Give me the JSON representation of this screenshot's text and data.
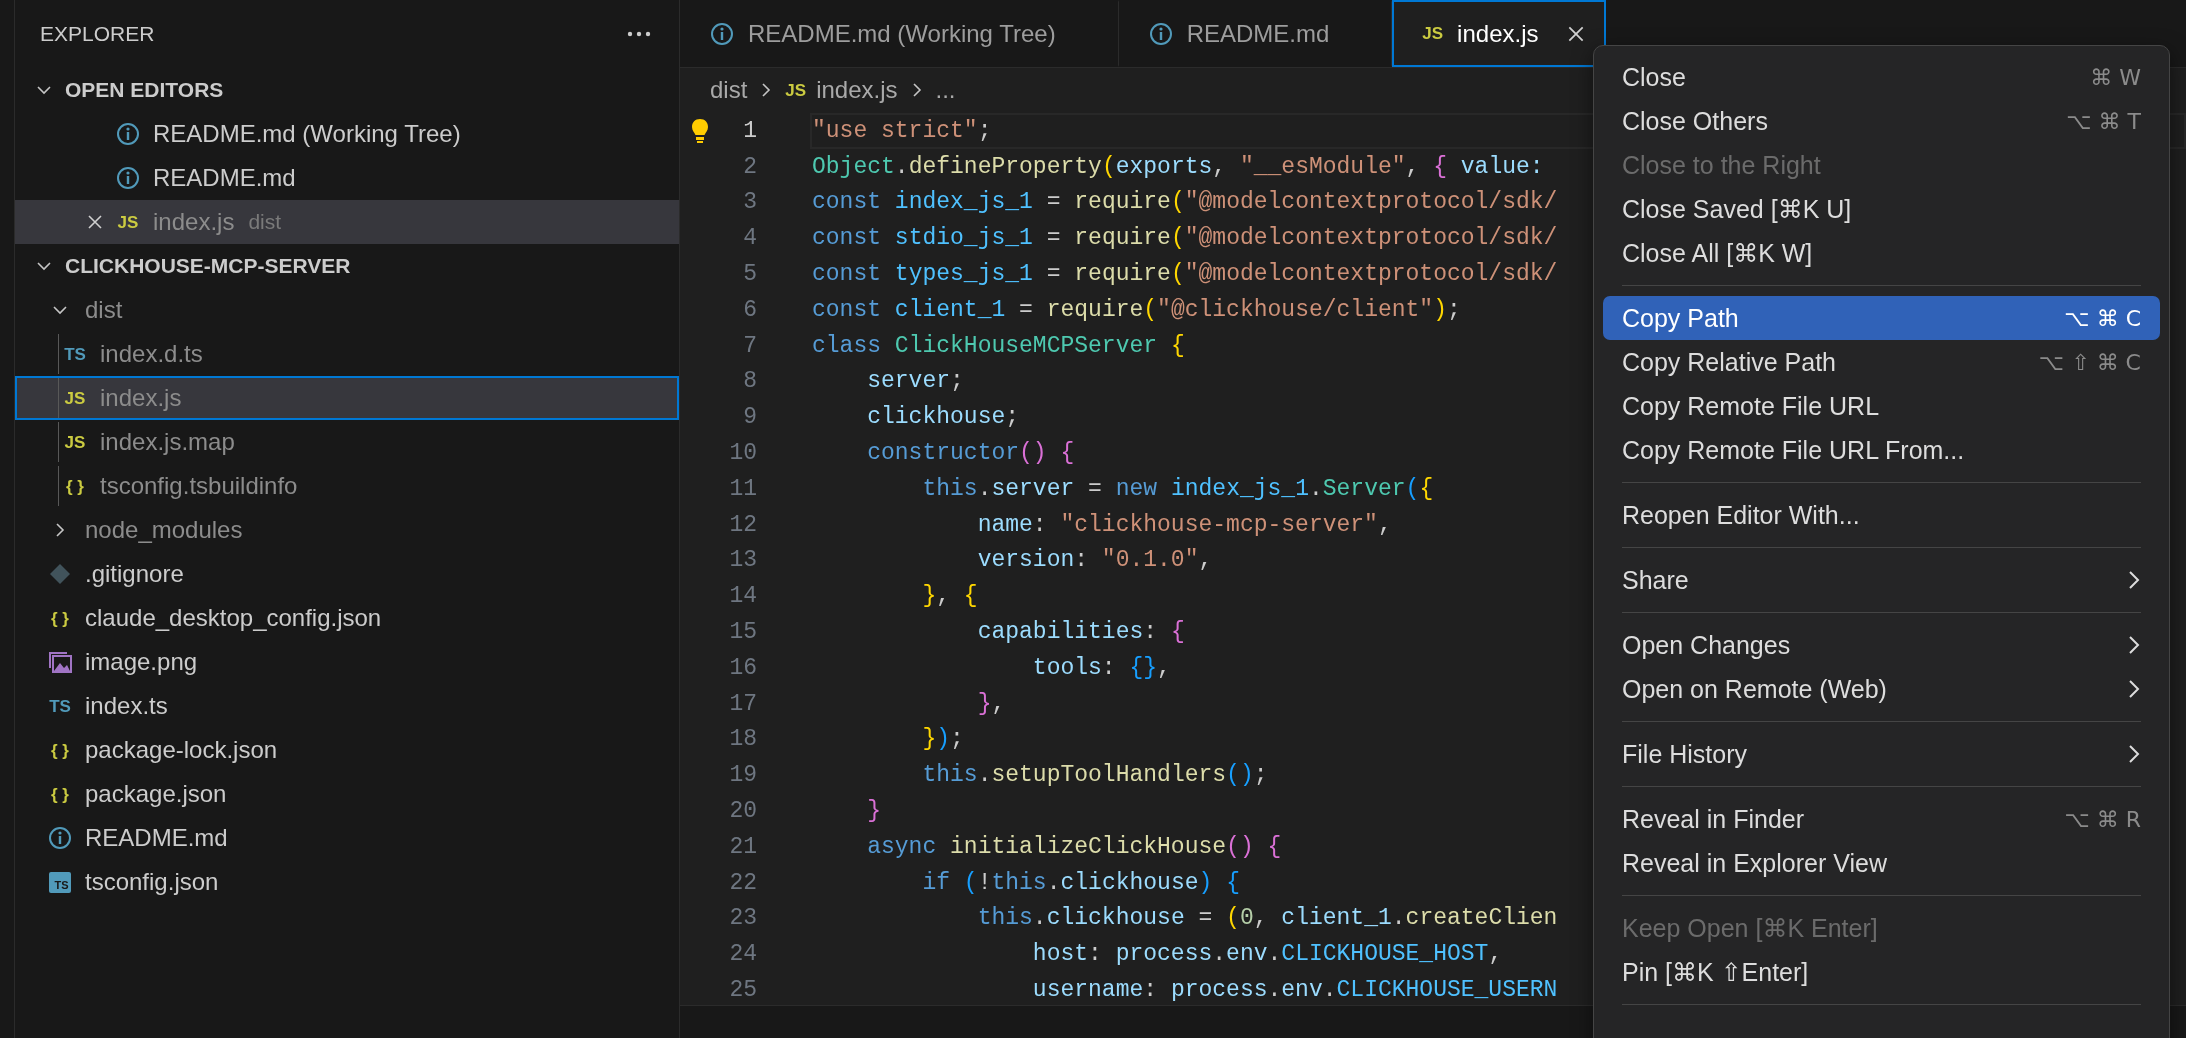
{
  "sidebar": {
    "title": "EXPLORER",
    "sections": [
      {
        "title": "OPEN EDITORS",
        "kind": "editors",
        "expanded": true,
        "items": [
          {
            "name": "README.md (Working Tree)",
            "kind": "info",
            "selected": false,
            "dimmed": false
          },
          {
            "name": "README.md",
            "kind": "info",
            "selected": false,
            "dimmed": false
          },
          {
            "name": "index.js",
            "detail": "dist",
            "kind": "js",
            "badge": "JS",
            "selected": true,
            "dimmed": true
          }
        ]
      },
      {
        "title": "CLICKHOUSE-MCP-SERVER",
        "kind": "tree",
        "expanded": true,
        "items": [
          {
            "kind": "folder",
            "name": "dist",
            "expanded": true,
            "selected": false,
            "dimmed": true,
            "children": [
              {
                "kind": "ts",
                "name": "index.d.ts",
                "badge": "TS",
                "selected": false,
                "dimmed": true
              },
              {
                "kind": "js",
                "name": "index.js",
                "badge": "JS",
                "selected": true,
                "dimmed": true
              },
              {
                "kind": "js",
                "name": "index.js.map",
                "badge": "JS",
                "selected": false,
                "dimmed": true
              },
              {
                "kind": "json",
                "name": "tsconfig.tsbuildinfo",
                "badge": "{ }",
                "selected": false,
                "dimmed": true
              }
            ]
          },
          {
            "kind": "folder",
            "name": "node_modules",
            "expanded": false,
            "selected": false,
            "dimmed": true
          },
          {
            "kind": "git",
            "name": ".gitignore",
            "selected": false,
            "dimmed": false
          },
          {
            "kind": "json",
            "name": "claude_desktop_config.json",
            "badge": "{ }",
            "selected": false,
            "dimmed": false
          },
          {
            "kind": "image",
            "name": "image.png",
            "selected": false,
            "dimmed": false
          },
          {
            "kind": "ts",
            "name": "index.ts",
            "badge": "TS",
            "selected": false,
            "dimmed": false
          },
          {
            "kind": "json",
            "name": "package-lock.json",
            "badge": "{ }",
            "selected": false,
            "dimmed": false
          },
          {
            "kind": "json",
            "name": "package.json",
            "badge": "{ }",
            "selected": false,
            "dimmed": false
          },
          {
            "kind": "info",
            "name": "README.md",
            "selected": false,
            "dimmed": false
          },
          {
            "kind": "tsconfig",
            "name": "tsconfig.json",
            "badge": "TS",
            "selected": false,
            "dimmed": false
          }
        ]
      }
    ]
  },
  "tabs": [
    {
      "label": "README.md (Working Tree)",
      "kind": "info",
      "selected": false
    },
    {
      "label": "README.md",
      "kind": "info",
      "selected": false
    },
    {
      "label": "index.js",
      "kind": "js",
      "badge": "JS",
      "selected": true
    }
  ],
  "breadcrumbs": [
    {
      "label": "dist"
    },
    {
      "label": "index.js",
      "kind": "js",
      "badge": "JS"
    },
    {
      "label": "..."
    }
  ],
  "editor": {
    "lines": [
      {
        "number": "1",
        "current": true,
        "tokens": [
          {
            "text": "\"use strict\"",
            "kind": "string"
          },
          {
            "text": ";",
            "kind": "plain"
          }
        ]
      },
      {
        "number": "2",
        "current": false,
        "tokens": [
          {
            "text": "Object",
            "kind": "class"
          },
          {
            "text": ".",
            "kind": "plain"
          },
          {
            "text": "defineProperty",
            "kind": "func"
          },
          {
            "text": "(",
            "kind": "bracket1"
          },
          {
            "text": "exports",
            "kind": "var"
          },
          {
            "text": ", ",
            "kind": "plain"
          },
          {
            "text": "\"__esModule\"",
            "kind": "string"
          },
          {
            "text": ", ",
            "kind": "plain"
          },
          {
            "text": "{",
            "kind": "bracket2"
          },
          {
            "text": " value:",
            "kind": "var"
          }
        ]
      },
      {
        "number": "3",
        "current": false,
        "tokens": [
          {
            "text": "const ",
            "kind": "keyword"
          },
          {
            "text": "index_js_1",
            "kind": "const"
          },
          {
            "text": " = ",
            "kind": "plain"
          },
          {
            "text": "require",
            "kind": "func"
          },
          {
            "text": "(",
            "kind": "bracket1"
          },
          {
            "text": "\"@modelcontextprotocol/sdk/",
            "kind": "string"
          }
        ]
      },
      {
        "number": "4",
        "current": false,
        "tokens": [
          {
            "text": "const ",
            "kind": "keyword"
          },
          {
            "text": "stdio_js_1",
            "kind": "const"
          },
          {
            "text": " = ",
            "kind": "plain"
          },
          {
            "text": "require",
            "kind": "func"
          },
          {
            "text": "(",
            "kind": "bracket1"
          },
          {
            "text": "\"@modelcontextprotocol/sdk/",
            "kind": "string"
          }
        ]
      },
      {
        "number": "5",
        "current": false,
        "tokens": [
          {
            "text": "const ",
            "kind": "keyword"
          },
          {
            "text": "types_js_1",
            "kind": "const"
          },
          {
            "text": " = ",
            "kind": "plain"
          },
          {
            "text": "require",
            "kind": "func"
          },
          {
            "text": "(",
            "kind": "bracket1"
          },
          {
            "text": "\"@modelcontextprotocol/sdk/",
            "kind": "string"
          }
        ]
      },
      {
        "number": "6",
        "current": false,
        "tokens": [
          {
            "text": "const ",
            "kind": "keyword"
          },
          {
            "text": "client_1",
            "kind": "const"
          },
          {
            "text": " = ",
            "kind": "plain"
          },
          {
            "text": "require",
            "kind": "func"
          },
          {
            "text": "(",
            "kind": "bracket1"
          },
          {
            "text": "\"@clickhouse/client\"",
            "kind": "string"
          },
          {
            "text": ")",
            "kind": "bracket1"
          },
          {
            "text": ";",
            "kind": "plain"
          }
        ]
      },
      {
        "number": "7",
        "current": false,
        "tokens": [
          {
            "text": "class ",
            "kind": "keyword"
          },
          {
            "text": "ClickHouseMCPServer",
            "kind": "class"
          },
          {
            "text": " {",
            "kind": "bracket1"
          }
        ]
      },
      {
        "number": "8",
        "current": false,
        "tokens": [
          {
            "text": "    server",
            "kind": "var"
          },
          {
            "text": ";",
            "kind": "plain"
          }
        ]
      },
      {
        "number": "9",
        "current": false,
        "tokens": [
          {
            "text": "    clickhouse",
            "kind": "var"
          },
          {
            "text": ";",
            "kind": "plain"
          }
        ]
      },
      {
        "number": "10",
        "current": false,
        "tokens": [
          {
            "text": "    constructor",
            "kind": "keyword"
          },
          {
            "text": "()",
            "kind": "bracket2"
          },
          {
            "text": " {",
            "kind": "bracket2"
          }
        ]
      },
      {
        "number": "11",
        "current": false,
        "tokens": [
          {
            "text": "        this",
            "kind": "keyword"
          },
          {
            "text": ".",
            "kind": "plain"
          },
          {
            "text": "server",
            "kind": "var"
          },
          {
            "text": " = ",
            "kind": "plain"
          },
          {
            "text": "new ",
            "kind": "keyword"
          },
          {
            "text": "index_js_1",
            "kind": "const"
          },
          {
            "text": ".",
            "kind": "plain"
          },
          {
            "text": "Server",
            "kind": "class"
          },
          {
            "text": "(",
            "kind": "bracket3"
          },
          {
            "text": "{",
            "kind": "bracket1"
          }
        ]
      },
      {
        "number": "12",
        "current": false,
        "tokens": [
          {
            "text": "            name",
            "kind": "var"
          },
          {
            "text": ": ",
            "kind": "plain"
          },
          {
            "text": "\"clickhouse-mcp-server\"",
            "kind": "string"
          },
          {
            "text": ",",
            "kind": "plain"
          }
        ]
      },
      {
        "number": "13",
        "current": false,
        "tokens": [
          {
            "text": "            version",
            "kind": "var"
          },
          {
            "text": ": ",
            "kind": "plain"
          },
          {
            "text": "\"0.1.0\"",
            "kind": "string"
          },
          {
            "text": ",",
            "kind": "plain"
          }
        ]
      },
      {
        "number": "14",
        "current": false,
        "tokens": [
          {
            "text": "        }",
            "kind": "bracket1"
          },
          {
            "text": ", ",
            "kind": "plain"
          },
          {
            "text": "{",
            "kind": "bracket1"
          }
        ]
      },
      {
        "number": "15",
        "current": false,
        "tokens": [
          {
            "text": "            capabilities",
            "kind": "var"
          },
          {
            "text": ": ",
            "kind": "plain"
          },
          {
            "text": "{",
            "kind": "bracket2"
          }
        ]
      },
      {
        "number": "16",
        "current": false,
        "tokens": [
          {
            "text": "                tools",
            "kind": "var"
          },
          {
            "text": ": ",
            "kind": "plain"
          },
          {
            "text": "{}",
            "kind": "bracket3"
          },
          {
            "text": ",",
            "kind": "plain"
          }
        ]
      },
      {
        "number": "17",
        "current": false,
        "tokens": [
          {
            "text": "            }",
            "kind": "bracket2"
          },
          {
            "text": ",",
            "kind": "plain"
          }
        ]
      },
      {
        "number": "18",
        "current": false,
        "tokens": [
          {
            "text": "        }",
            "kind": "bracket1"
          },
          {
            "text": ")",
            "kind": "bracket3"
          },
          {
            "text": ";",
            "kind": "plain"
          }
        ]
      },
      {
        "number": "19",
        "current": false,
        "tokens": [
          {
            "text": "        this",
            "kind": "keyword"
          },
          {
            "text": ".",
            "kind": "plain"
          },
          {
            "text": "setupToolHandlers",
            "kind": "func"
          },
          {
            "text": "()",
            "kind": "bracket3"
          },
          {
            "text": ";",
            "kind": "plain"
          }
        ]
      },
      {
        "number": "20",
        "current": false,
        "tokens": [
          {
            "text": "    }",
            "kind": "bracket2"
          }
        ]
      },
      {
        "number": "21",
        "current": false,
        "tokens": [
          {
            "text": "    async ",
            "kind": "keyword"
          },
          {
            "text": "initializeClickHouse",
            "kind": "func"
          },
          {
            "text": "()",
            "kind": "bracket2"
          },
          {
            "text": " {",
            "kind": "bracket2"
          }
        ]
      },
      {
        "number": "22",
        "current": false,
        "tokens": [
          {
            "text": "        if ",
            "kind": "keyword"
          },
          {
            "text": "(",
            "kind": "bracket3"
          },
          {
            "text": "!",
            "kind": "plain"
          },
          {
            "text": "this",
            "kind": "keyword"
          },
          {
            "text": ".",
            "kind": "plain"
          },
          {
            "text": "clickhouse",
            "kind": "var"
          },
          {
            "text": ")",
            "kind": "bracket3"
          },
          {
            "text": " {",
            "kind": "bracket3"
          }
        ]
      },
      {
        "number": "23",
        "current": false,
        "tokens": [
          {
            "text": "            this",
            "kind": "keyword"
          },
          {
            "text": ".",
            "kind": "plain"
          },
          {
            "text": "clickhouse",
            "kind": "var"
          },
          {
            "text": " = ",
            "kind": "plain"
          },
          {
            "text": "(",
            "kind": "bracket1"
          },
          {
            "text": "0",
            "kind": "number"
          },
          {
            "text": ", ",
            "kind": "plain"
          },
          {
            "text": "client_1",
            "kind": "var"
          },
          {
            "text": ".",
            "kind": "plain"
          },
          {
            "text": "createClien",
            "kind": "func"
          }
        ]
      },
      {
        "number": "24",
        "current": false,
        "tokens": [
          {
            "text": "                host",
            "kind": "var"
          },
          {
            "text": ": ",
            "kind": "plain"
          },
          {
            "text": "process",
            "kind": "var"
          },
          {
            "text": ".",
            "kind": "plain"
          },
          {
            "text": "env",
            "kind": "var"
          },
          {
            "text": ".",
            "kind": "plain"
          },
          {
            "text": "CLICKHOUSE_HOST",
            "kind": "const"
          },
          {
            "text": ",",
            "kind": "plain"
          }
        ]
      },
      {
        "number": "25",
        "current": false,
        "tokens": [
          {
            "text": "                username",
            "kind": "var"
          },
          {
            "text": ": ",
            "kind": "plain"
          },
          {
            "text": "process",
            "kind": "var"
          },
          {
            "text": ".",
            "kind": "plain"
          },
          {
            "text": "env",
            "kind": "var"
          },
          {
            "text": ".",
            "kind": "plain"
          },
          {
            "text": "CLICKHOUSE_USERN",
            "kind": "const"
          }
        ]
      }
    ]
  },
  "context_menu": {
    "groups": [
      {
        "items": [
          {
            "label": "Close",
            "shortcut": "⌘ W",
            "disabled": false,
            "selected": false,
            "submenu": false
          },
          {
            "label": "Close Others",
            "shortcut": "⌥ ⌘ T",
            "disabled": false,
            "selected": false,
            "submenu": false
          },
          {
            "label": "Close to the Right",
            "disabled": true,
            "selected": false,
            "submenu": false
          },
          {
            "label": "Close Saved [⌘K U]",
            "disabled": false,
            "selected": false,
            "submenu": false
          },
          {
            "label": "Close All [⌘K W]",
            "disabled": false,
            "selected": false,
            "submenu": false
          }
        ]
      },
      {
        "items": [
          {
            "label": "Copy Path",
            "shortcut": "⌥ ⌘ C",
            "disabled": false,
            "selected": true,
            "submenu": false
          },
          {
            "label": "Copy Relative Path",
            "shortcut": "⌥ ⇧ ⌘ C",
            "disabled": false,
            "selected": false,
            "submenu": false
          },
          {
            "label": "Copy Remote File URL",
            "disabled": false,
            "selected": false,
            "submenu": false
          },
          {
            "label": "Copy Remote File URL From...",
            "disabled": false,
            "selected": false,
            "submenu": false
          }
        ]
      },
      {
        "items": [
          {
            "label": "Reopen Editor With...",
            "disabled": false,
            "selected": false,
            "submenu": false
          }
        ]
      },
      {
        "items": [
          {
            "label": "Share",
            "disabled": false,
            "selected": false,
            "submenu": true
          }
        ]
      },
      {
        "items": [
          {
            "label": "Open Changes",
            "disabled": false,
            "selected": false,
            "submenu": true
          },
          {
            "label": "Open on Remote (Web)",
            "disabled": false,
            "selected": false,
            "submenu": true
          }
        ]
      },
      {
        "items": [
          {
            "label": "File History",
            "disabled": false,
            "selected": false,
            "submenu": true
          }
        ]
      },
      {
        "items": [
          {
            "label": "Reveal in Finder",
            "shortcut": "⌥ ⌘ R",
            "disabled": false,
            "selected": false,
            "submenu": false
          },
          {
            "label": "Reveal in Explorer View",
            "disabled": false,
            "selected": false,
            "submenu": false
          }
        ]
      },
      {
        "items": [
          {
            "label": "Keep Open [⌘K Enter]",
            "disabled": true,
            "selected": false,
            "submenu": false
          },
          {
            "label": "Pin [⌘K ⇧Enter]",
            "disabled": false,
            "selected": false,
            "submenu": false
          }
        ]
      }
    ]
  }
}
